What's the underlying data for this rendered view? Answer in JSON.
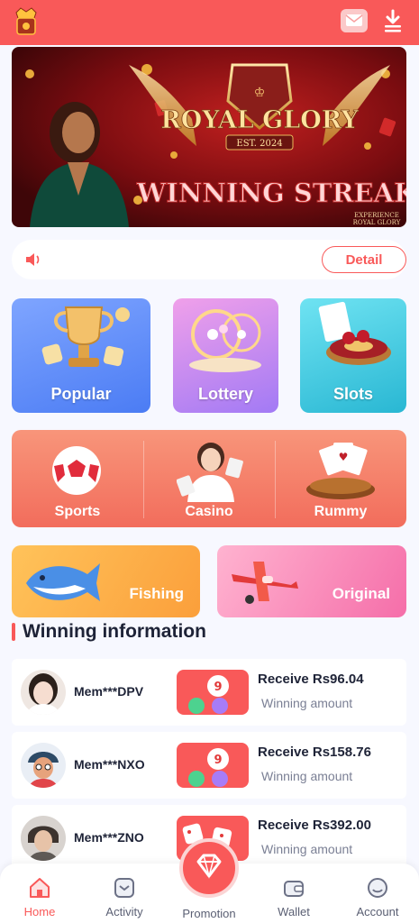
{
  "header": {
    "logo_icon": "royal-glory-crest-icon",
    "mail_icon": "mail-icon",
    "download_icon": "download-icon"
  },
  "banner": {
    "brand_line1": "ROYAL GLORY",
    "est": "EST. 2024",
    "headline": "WINNING STREAK",
    "footer_line1": "EXPERIENCE",
    "footer_line2": "ROYAL GLORY"
  },
  "notice": {
    "speaker_icon": "speaker-icon",
    "detail_label": "Detail"
  },
  "categories": {
    "popular": "Popular",
    "lottery": "Lottery",
    "slots": "Slots",
    "sports": "Sports",
    "casino": "Casino",
    "rummy": "Rummy",
    "fishing": "Fishing",
    "original": "Original"
  },
  "winning": {
    "title": "Winning information",
    "rows": [
      {
        "user": "Mem***DPV",
        "amount": "Receive Rs96.04",
        "sub": "Winning amount"
      },
      {
        "user": "Mem***NXO",
        "amount": "Receive Rs158.76",
        "sub": "Winning amount"
      },
      {
        "user": "Mem***ZNO",
        "amount": "Receive Rs392.00",
        "sub": "Winning amount"
      }
    ]
  },
  "nav": {
    "home": "Home",
    "activity": "Activity",
    "promotion": "Promotion",
    "wallet": "Wallet",
    "account": "Account"
  },
  "colors": {
    "accent": "#f95959",
    "background": "#f7f8ff",
    "text": "#1e2337"
  }
}
